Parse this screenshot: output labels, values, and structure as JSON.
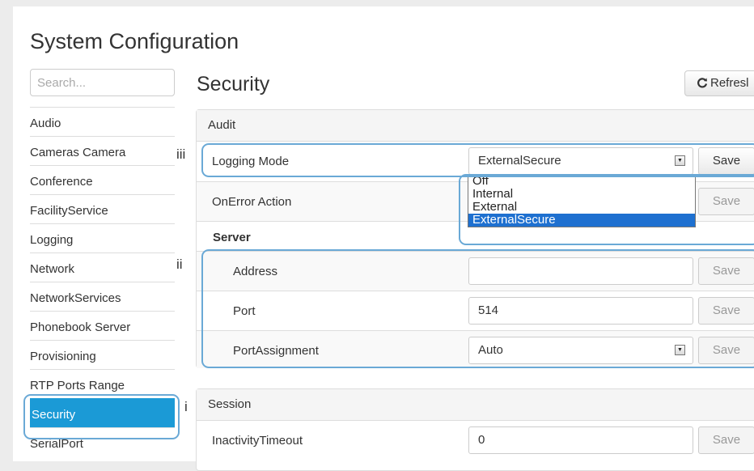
{
  "page": {
    "title": "System Configuration"
  },
  "search": {
    "placeholder": "Search..."
  },
  "sidebar": {
    "items": [
      {
        "label": "Audio",
        "active": false
      },
      {
        "label": "Cameras Camera",
        "active": false
      },
      {
        "label": "Conference",
        "active": false
      },
      {
        "label": "FacilityService",
        "active": false
      },
      {
        "label": "Logging",
        "active": false
      },
      {
        "label": "Network",
        "active": false
      },
      {
        "label": "NetworkServices",
        "active": false
      },
      {
        "label": "Phonebook Server",
        "active": false
      },
      {
        "label": "Provisioning",
        "active": false
      },
      {
        "label": "RTP Ports Range",
        "active": false
      },
      {
        "label": "Security",
        "active": true
      },
      {
        "label": "SerialPort",
        "active": false
      }
    ]
  },
  "main": {
    "title": "Security",
    "refresh_label": "Refresl",
    "refresh_icon": "refresh-icon",
    "audit": {
      "heading": "Audit",
      "logging_mode": {
        "label": "Logging Mode",
        "value": "ExternalSecure",
        "save": "Save"
      },
      "on_error_action": {
        "label": "OnError Action",
        "save": "Save"
      },
      "server": {
        "heading": "Server",
        "address": {
          "label": "Address",
          "value": "",
          "save": "Save"
        },
        "port": {
          "label": "Port",
          "value": "514",
          "save": "Save"
        },
        "port_assignment": {
          "label": "PortAssignment",
          "value": "Auto",
          "save": "Save"
        }
      }
    },
    "session": {
      "heading": "Session",
      "inactivity_timeout": {
        "label": "InactivityTimeout",
        "value": "0",
        "save": "Save"
      }
    }
  },
  "dropdown": {
    "options": [
      "Off",
      "Internal",
      "External",
      "ExternalSecure"
    ],
    "selected": "ExternalSecure"
  },
  "annotations": {
    "i": "i",
    "ii": "ii",
    "iii": "iii"
  },
  "colors": {
    "accent": "#1b9ad6",
    "highlight": "#6aa9d6",
    "dropdown_selected": "#1e70d0"
  }
}
